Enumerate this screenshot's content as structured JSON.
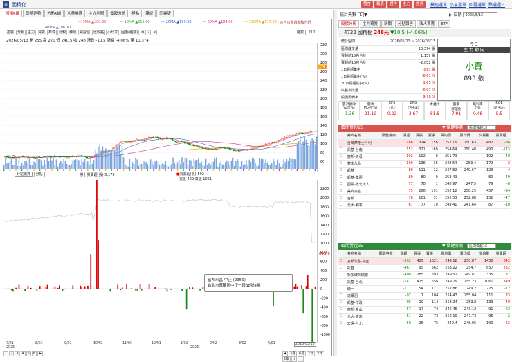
{
  "app": {
    "title": "國精化",
    "topButtons": [
      "發言",
      "報表",
      "證件",
      "主力",
      "證券"
    ],
    "topLinks": [
      "模組選單",
      "交易選單",
      "回覆選單",
      "點選週日"
    ]
  },
  "tabs": [
    "國精K線",
    "即時走勢",
    "分點K線",
    "大量券商",
    "主力地圖",
    "個股分析",
    "極點",
    "筆記",
    "同業版"
  ],
  "ma": [
    {
      "label": "5MA",
      "value": "▲208.60",
      "color": "#d9534f"
    },
    {
      "label": "10MA",
      "value": "▲211.60",
      "color": "#33a033"
    },
    {
      "label": "20MA",
      "value": "▲199.58",
      "color": "#3366cc"
    },
    {
      "label": "60MA",
      "value": "▲184.08",
      "color": "#cc3399"
    },
    {
      "label": "120MA",
      "value": "▲177.33",
      "color": "#e0a000"
    }
  ],
  "ma240": "▲186.70",
  "maNote": "◎自訂整週收稿分析",
  "tools": [
    "指標",
    "分析",
    "主力",
    "買賣",
    "有件",
    "比較",
    "稀疏",
    "買點位",
    "比較點",
    "小尺寸",
    "回價(縮放)"
  ],
  "zoom": "210",
  "ohlc": "2026/05/13 開 255 高 270 低 240.5 收 248  漲跌 -10.5 漲幅 -4.06% 量 10,374",
  "priceAxis": [
    "320",
    "300",
    "280",
    "260",
    "240",
    "220",
    "200",
    "180",
    "160",
    "140",
    "120",
    "100",
    "80",
    "60"
  ],
  "lastPrice": "270",
  "lowLabel": "61.3",
  "lowerLegend": {
    "select": "分點選擇",
    "btn": "分點",
    "line1": "一 累計買賣超(張)-5,179",
    "line2": "買賣超(張)-592",
    "line3": "買張 429 賣張 1021"
  },
  "lowerAxis": [
    "2200",
    "2000",
    "1800",
    "1600",
    "1400",
    "1200",
    "1000",
    "800",
    "600",
    "400",
    "200",
    "0",
    "-200",
    "-400",
    "-600",
    "-800",
    "-1000"
  ],
  "lowerLast": "693.6",
  "dates": [
    "7/01",
    "8/01",
    "9/01",
    "10/01",
    "11/03",
    "12/01",
    "1/02",
    "2/02",
    "3/02",
    "4/01",
    "2026/05/13"
  ],
  "years": [
    "2025",
    "2026"
  ],
  "pager": [
    "1",
    "2",
    "3",
    "4",
    "5",
    "6"
  ],
  "rangeBtns": [
    "3月",
    "6月",
    "1年",
    "2年",
    "5年"
  ],
  "tooltip": {
    "line1": "富邦永昌-中正 (9359)",
    "line2": "台北市萬華區中正一段38號4樓"
  },
  "right": {
    "selLabel": "統計天數",
    "selVal": "1",
    "dateLabel": "日期",
    "dateVal": "2026/5/13",
    "tabs": [
      "股價分析",
      "主力買賣",
      "新聞",
      "分點報告",
      "法人買賣",
      "ETF"
    ],
    "stock": "4722 國精化",
    "price": "248元",
    "chg": "▼10.5 (-4.06%)",
    "stats": [
      [
        "統計區間",
        "2026/05/13 ~ 2026/05/13",
        ""
      ],
      [
        "區間成交量",
        "10,374 張",
        ""
      ],
      [
        "買超前15名合計",
        "1,159 張",
        ""
      ],
      [
        "賣超前15名合計",
        "-2,052 張",
        ""
      ],
      [
        "1日買超集中",
        "-893 張",
        ""
      ],
      [
        "1日買超集中(%)",
        "-8.61 %",
        ""
      ],
      [
        "20日買超集中(%)",
        "1.65 %",
        ""
      ],
      [
        "佔股本比重",
        "-0.87 %",
        ""
      ],
      [
        "股價周轉率",
        "9.78 %",
        ""
      ]
    ],
    "todayTitle": "今日",
    "todayHead": "主 力 動 向",
    "todayLabel": "小賣",
    "todayVal": "893 張",
    "fin": [
      [
        "累計營收\nYoY(%)",
        "-1.36"
      ],
      [
        "營收\nMoM(%)",
        "21.19"
      ],
      [
        "EPS\n(元)",
        "0.22"
      ],
      [
        "EPS\n(近4季)",
        "3.67"
      ],
      [
        "本益比",
        "81.8"
      ],
      [
        "股價\n淨值比",
        "7.91"
      ],
      [
        "殖利率\n(%)",
        "0.48"
      ],
      [
        "ROE\n(近4季)",
        "5.5"
      ]
    ],
    "buyTitle": "區間買超15",
    "sellTitle": "區間賣超15",
    "sortLabel": "▼ 關鍵券商",
    "sortSel": "區間買超15",
    "sortSel2": "區間賣超15",
    "cols": [
      "券商名稱",
      "關鍵券商",
      "買超",
      "買張",
      "賣張",
      "買均價",
      "賣均價",
      "交易量",
      "買賣超"
    ],
    "buyRows": [
      [
        "台灣摩根士丹利",
        "",
        "166",
        "324",
        "158",
        "252.16",
        "250.63",
        "482",
        "-86"
      ],
      [
        "凱基-台南",
        "",
        "152",
        "321",
        "169",
        "254.64",
        "250.48",
        "490",
        "-173"
      ],
      [
        "富邦-天母",
        "",
        "102",
        "102",
        "0",
        "251.79",
        "--",
        "102",
        "-40"
      ],
      [
        "華南永昌",
        "",
        "100",
        "136",
        "36",
        "248.54",
        "253.4",
        "172",
        "2"
      ],
      [
        "凱基",
        "",
        "89",
        "111",
        "12",
        "247.82",
        "249.67",
        "123",
        "4"
      ],
      [
        "凱基-蕭蘑",
        "",
        "80",
        "80",
        "0",
        "253.49",
        "--",
        "80",
        "-49"
      ],
      [
        "國票-敦北法人",
        "",
        "77",
        "78",
        "1",
        "248.97",
        "247.5",
        "79",
        "-8"
      ],
      [
        "美商高盛",
        "",
        "75",
        "266",
        "191",
        "252.12",
        "250.25",
        "457",
        "-94"
      ],
      [
        "台新",
        "",
        "70",
        "101",
        "31",
        "252.53",
        "252.88",
        "132",
        "-47"
      ],
      [
        "元大-和平",
        "",
        "67",
        "77",
        "10",
        "249.41",
        "247.64",
        "87",
        "-10"
      ]
    ],
    "sellRows": [
      [
        "富邦永昌-中正",
        "",
        "-592",
        "429",
        "1021",
        "249.18",
        "250.87",
        "1450",
        "842"
      ],
      [
        "凱基",
        "",
        "-467",
        "95",
        "562",
        "263.22",
        "254.7",
        "657",
        "232"
      ],
      [
        "新加坡商瑞銀",
        "",
        "-408",
        "285",
        "693",
        "249.52",
        "249.81",
        "335",
        "37"
      ],
      [
        "凱基-台北",
        "",
        "-141",
        "415",
        "556",
        "249.79",
        "255.23",
        "1061",
        "349"
      ],
      [
        "統一",
        "",
        "-117",
        "54",
        "171",
        "252.86",
        "249.2",
        "225",
        "-12"
      ],
      [
        "達爾羽",
        "",
        "-97",
        "7",
        "104",
        "254.43",
        "255.04",
        "111",
        "33"
      ],
      [
        "凱基-市政",
        "",
        "-95",
        "19",
        "114",
        "253.24",
        "253.8",
        "133",
        "49"
      ],
      [
        "富邦-金山",
        "",
        "-57",
        "17",
        "74",
        "246.45",
        "243.12",
        "91",
        "-63"
      ],
      [
        "元大-南京",
        "",
        "-51",
        "22",
        "73",
        "252.19",
        "247.73",
        "95",
        "-2"
      ],
      [
        "宏遠-台北",
        "",
        "-50",
        "25",
        "75",
        "249.4",
        "248.05",
        "100",
        "53"
      ]
    ]
  }
}
